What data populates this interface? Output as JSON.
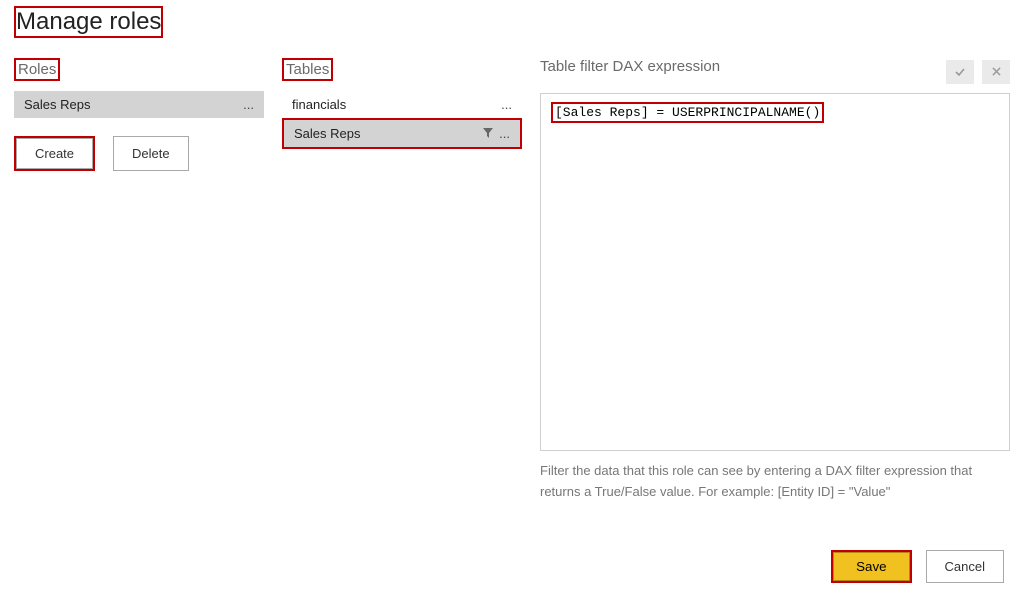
{
  "title": "Manage roles",
  "roles": {
    "heading": "Roles",
    "items": [
      {
        "name": "Sales Reps",
        "selected": true
      }
    ],
    "create_label": "Create",
    "delete_label": "Delete"
  },
  "tables": {
    "heading": "Tables",
    "items": [
      {
        "name": "financials",
        "selected": false,
        "filtered": false
      },
      {
        "name": "Sales Reps",
        "selected": true,
        "filtered": true
      }
    ]
  },
  "expression": {
    "heading": "Table filter DAX expression",
    "value": "[Sales Reps] = USERPRINCIPALNAME()",
    "help": "Filter the data that this role can see by entering a DAX filter expression that returns a True/False value. For example: [Entity ID] = \"Value\""
  },
  "footer": {
    "save_label": "Save",
    "cancel_label": "Cancel"
  }
}
